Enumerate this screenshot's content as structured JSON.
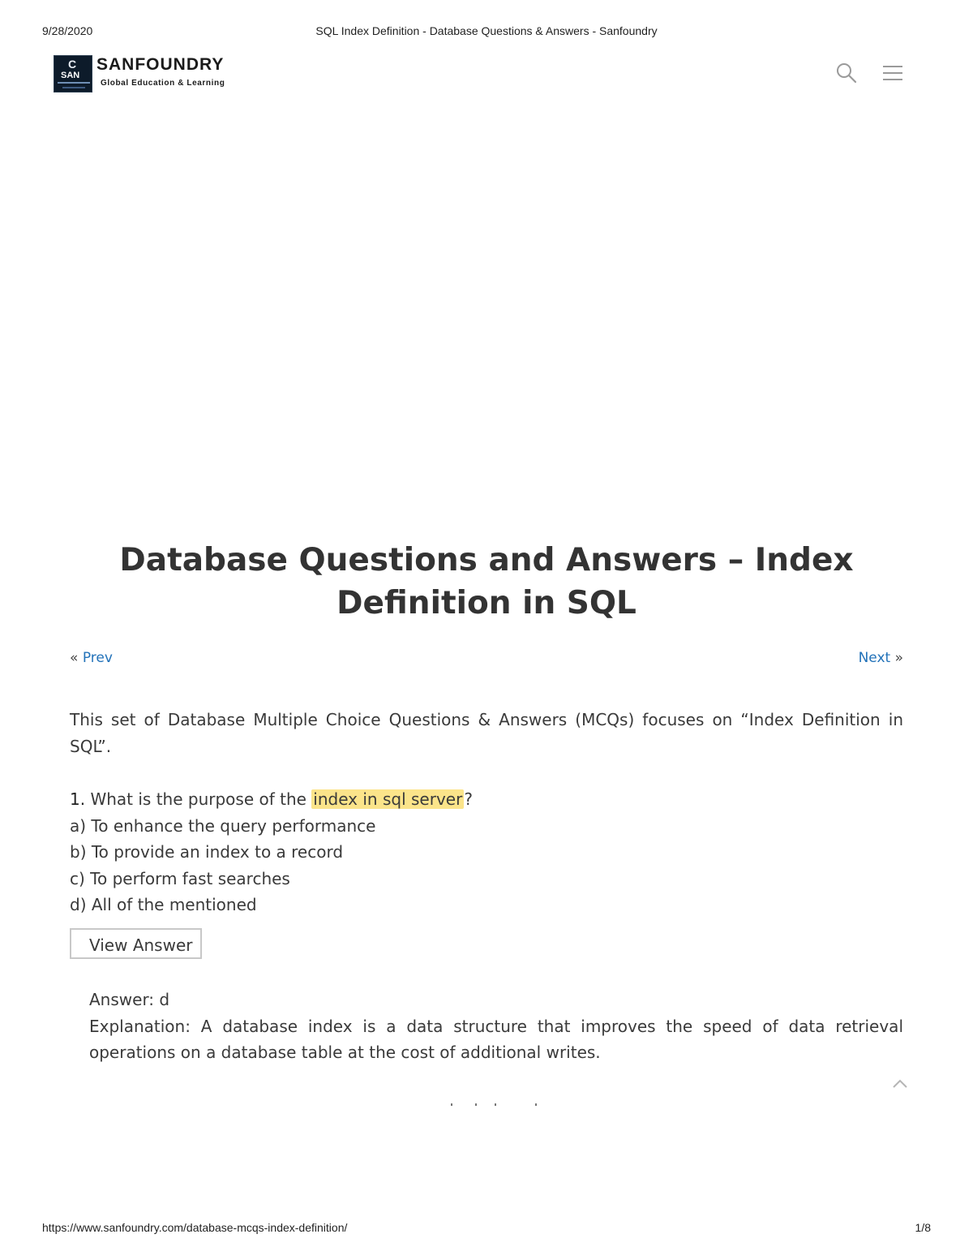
{
  "print_header": {
    "date": "9/28/2020",
    "title": "SQL Index Definition - Database Questions & Answers - Sanfoundry"
  },
  "brand": {
    "logo_letters_top": "C",
    "logo_letters_mid": "SAN",
    "name": "SANFOUNDRY",
    "tagline": "Global Education & Learning"
  },
  "header_icons": [
    "search-icon",
    "hamburger-menu-icon"
  ],
  "article": {
    "title": "Database Questions and Answers – Index Definition in SQL",
    "nav": {
      "prev_label": "Prev",
      "prev_marker": "«",
      "next_label": "Next",
      "next_marker": "»"
    },
    "intro": "This set of Database Multiple Choice Questions & Answers (MCQs) focuses on “Index Definition in SQL”."
  },
  "question": {
    "number": "1.",
    "text_before": " What is the purpose of the ",
    "highlighted": "index in sql server",
    "text_after": "?",
    "options": [
      "a) To enhance the query performance",
      "b) To provide an index to a record",
      "c) To perform fast searches",
      "d) All of the mentioned"
    ],
    "view_answer_label": "View Answer",
    "answer": "Answer: d",
    "explanation": "Explanation: A database index is a data structure that improves the speed of data retrieval operations on a database table at the cost of additional writes."
  },
  "colors": {
    "link": "#2272b9",
    "highlight": "#fbe48a",
    "text": "#3a3a3a",
    "logo_bg": "#0d1b2a"
  },
  "print_footer": {
    "url": "https://www.sanfoundry.com/database-mcqs-index-definition/",
    "page": "1/8"
  }
}
